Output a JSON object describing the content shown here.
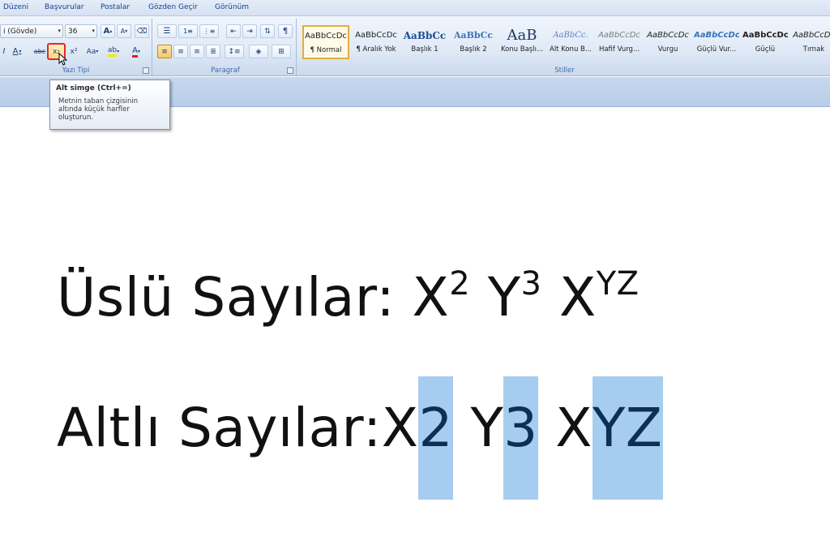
{
  "menu": [
    "Düzeni",
    "Başvurular",
    "Postalar",
    "Gözden Geçir",
    "Görünüm"
  ],
  "font": {
    "name_value": "i (Gövde)",
    "size_value": "36",
    "group_label": "Yazı Tipi",
    "grow_label": "A",
    "shrink_label": "A",
    "strike_label": "abc",
    "subscript_label": "x₂",
    "superscript_label": "x²",
    "case_label": "Aa",
    "italic_label": "I",
    "underline_label": "A",
    "color_label": "A",
    "highlight_label": "ab"
  },
  "paragraph": {
    "group_label": "Paragraf"
  },
  "styles": {
    "group_label": "Stiller",
    "items": [
      {
        "sample": "AaBbCcDc",
        "name": "¶ Normal"
      },
      {
        "sample": "AaBbCcDc",
        "name": "¶ Aralık Yok"
      },
      {
        "sample": "AaBbCc",
        "name": "Başlık 1"
      },
      {
        "sample": "AaBbCc",
        "name": "Başlık 2"
      },
      {
        "sample": "AaB",
        "name": "Konu Başlı..."
      },
      {
        "sample": "AaBbCc.",
        "name": "Alt Konu B..."
      },
      {
        "sample": "AaBbCcDc",
        "name": "Hafif Vurg..."
      },
      {
        "sample": "AaBbCcDc",
        "name": "Vurgu"
      },
      {
        "sample": "AaBbCcDc",
        "name": "Güçlü Vur..."
      },
      {
        "sample": "AaBbCcDc",
        "name": "Güçlü"
      },
      {
        "sample": "AaBbCcDc",
        "name": "Tırnak"
      }
    ]
  },
  "tooltip": {
    "title": "Alt simge (Ctrl+=)",
    "body": "Metnin taban çizgisinin\naltında küçük harfler\noluşturun."
  },
  "document": {
    "line1": {
      "label": "Üslü Sayılar: ",
      "x1": "X",
      "e1": "2",
      "y1": "Y",
      "e2": "3",
      "x2": "X",
      "e3": "YZ"
    },
    "line2": {
      "label": "Altlı Sayılar: ",
      "x1": "X",
      "s1": "2",
      "y1": "Y",
      "s2": "3",
      "x2": "X",
      "s3": "YZ"
    },
    "selection_color": "#a6cdef"
  }
}
